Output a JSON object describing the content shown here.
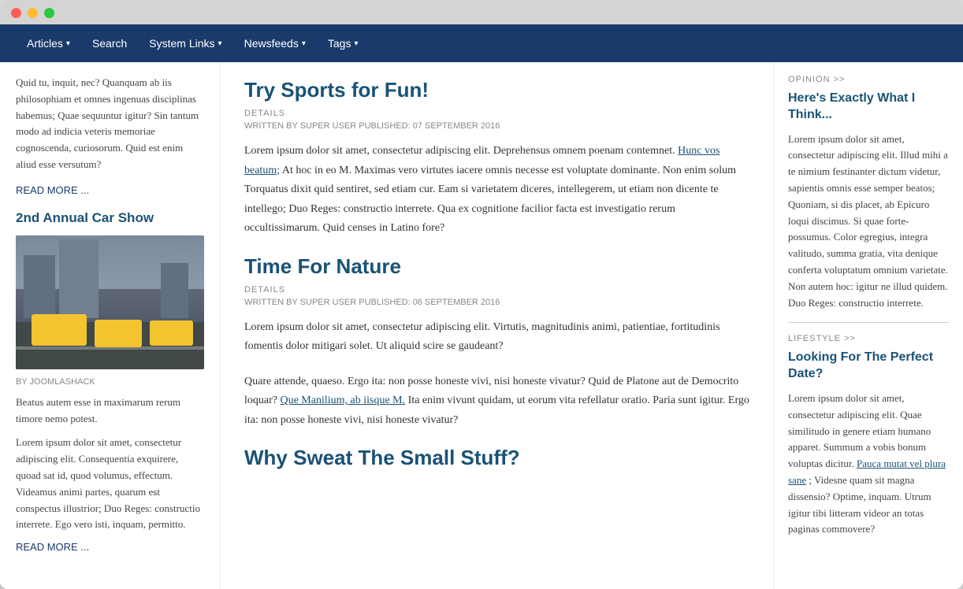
{
  "browser": {
    "traffic_lights": [
      "red",
      "yellow",
      "green"
    ]
  },
  "nav": {
    "items": [
      {
        "label": "Articles",
        "has_arrow": true
      },
      {
        "label": "Search",
        "has_arrow": false
      },
      {
        "label": "System Links",
        "has_arrow": true
      },
      {
        "label": "Newsfeeds",
        "has_arrow": true
      },
      {
        "label": "Tags",
        "has_arrow": true
      }
    ]
  },
  "left_col": {
    "intro_text": "Quid tu, inquit, nec? Quanquam ab iis philosophiam et omnes ingenuas disciplinas habemus; Quae sequuntur igitur? Sin tantum modo ad indicia veteris memoriae cognoscenda, curiosorum. Quid est enim aliud esse versutum?",
    "read_more": "READ MORE ...",
    "article_title": "2nd Annual Car Show",
    "by_author": "BY JOOMLASHACK",
    "body1": "Beatus autem esse in maximarum rerum timore nemo potest.",
    "body2": "Lorem ipsum dolor sit amet, consectetur adipiscing elit. Consequentia exquirere, quoad sat id, quod volumus, effectum. Videamus animi partes, quarum est conspectus illustrior; Duo Reges: constructio interrete. Ego vero isti, inquam, permitto.",
    "read_more2": "READ MORE ..."
  },
  "center_col": {
    "articles": [
      {
        "title": "Try Sports for Fun!",
        "details_label": "DETAILS",
        "meta": "WRITTEN BY SUPER USER   PUBLISHED: 07 SEPTEMBER 2016",
        "body": "Lorem ipsum dolor sit amet, consectetur adipiscing elit. Deprehensus omnem poenam contemnet. Hunc vos beatum; At hoc in eo M. Maximas vero virtutes iacere omnis necesse est voluptate dominante. Non enim solum Torquatus dixit quid sentiret, sed etiam cur. Eam si varietatem diceres, intellegerem, ut etiam non dicente te intellego; Duo Reges: constructio interrete. Qua ex cognitione facilior facta est investigatio rerum occultissimarum. Quid censes in Latino fore?",
        "inline_link": "Hunc vos beatum;"
      },
      {
        "title": "Time For Nature",
        "details_label": "DETAILS",
        "meta": "WRITTEN BY SUPER USER   PUBLISHED: 06 SEPTEMBER 2016",
        "body1": "Lorem ipsum dolor sit amet, consectetur adipiscing elit. Virtutis, magnitudinis animi, patientiae, fortitudinis fomentis dolor mitigari solet. Ut aliquid scire se gaudeant?",
        "body2": "Quare attende, quaeso. Ergo ita: non posse honeste vivi, nisi honeste vivatur? Quid de Platone aut de Democrito loquar? Que Manilium, ab iisque M. Ita enim vivunt quidam, ut eorum vita refellatur oratio. Paria sunt igitur. Ergo ita: non posse honeste vivi, nisi honeste vivatur?",
        "inline_link1": "Que Manilium, ab iisque M."
      },
      {
        "title": "Why Sweat The Small Stuff?"
      }
    ]
  },
  "right_col": {
    "sections": [
      {
        "section_label": "OPINION >>",
        "article_title": "Here's Exactly What I Think...",
        "body": "Lorem ipsum dolor sit amet, consectetur adipiscing elit. Illud mihi a te nimium festinanter dictum videtur, sapientis omnis esse semper beatos; Quoniam, si dis placet, ab Epicuro loqui discimus. Si quae forte-possumus. Color egregius, integra valitudo, summa gratia, vita denique conferta voluptatum omnium varietate. Non autem hoc: igitur ne illud quidem. Duo Reges: constructio interrete."
      },
      {
        "section_label": "LIFESTYLE >>",
        "article_title": "Looking For The Perfect Date?",
        "body1": "Lorem ipsum dolor sit amet, consectetur adipiscing elit. Quae similitudo in genere etiam humano apparet. Summum a vobis bonum voluptas dicitur.",
        "inline_link": "Pauca mutat vel plura sane",
        "body2": "; Videsne quam sit magna dissensio? Optime, inquam. Utrum igitur tibi litteram videor an totas paginas commovere?"
      }
    ]
  }
}
